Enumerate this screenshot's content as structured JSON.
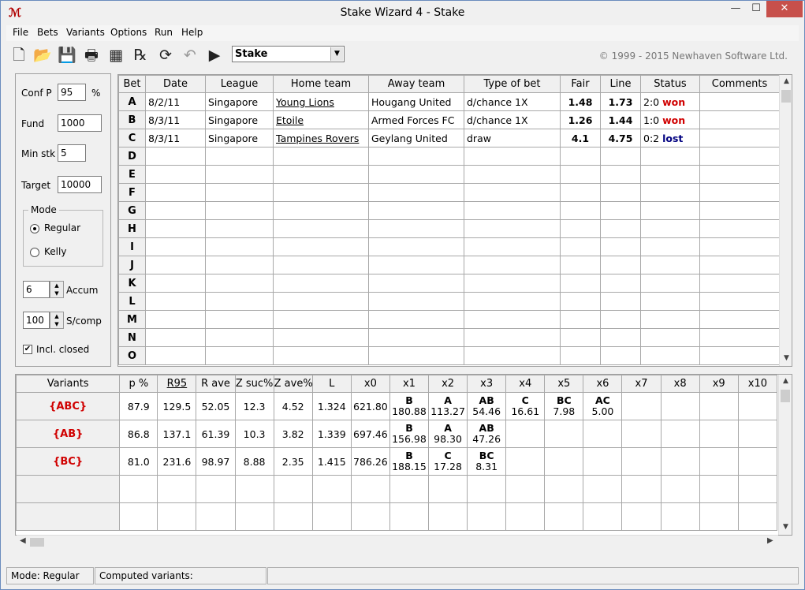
{
  "window": {
    "title": "Stake Wizard 4 - Stake",
    "icon_text": "SW",
    "min": "—",
    "max": "☐",
    "close": "✕"
  },
  "menu": [
    "File",
    "Bets",
    "Variants",
    "Options",
    "Run",
    "Help"
  ],
  "toolbar": {
    "icons": [
      "new-file-icon",
      "open-folder-icon",
      "save-icon",
      "print-icon",
      "calculator-icon",
      "results-icon",
      "refresh-icon",
      "undo-icon",
      "run-icon"
    ],
    "stake_selection": "Stake",
    "copyright": "© 1999 - 2015 Newhaven Software Ltd."
  },
  "params": {
    "conf_p_label": "Conf P",
    "conf_p": "95",
    "conf_p_unit": "%",
    "fund_label": "Fund",
    "fund": "1000",
    "min_stk_label": "Min stk",
    "min_stk": "5",
    "target_label": "Target",
    "target": "10000",
    "mode_label": "Mode",
    "mode_regular": "Regular",
    "mode_kelly": "Kelly",
    "mode_selected": "Regular",
    "accum": "6",
    "accum_label": "Accum",
    "scomp": "100",
    "scomp_label": "S/comp",
    "incl_closed_label": "Incl. closed",
    "incl_closed": true
  },
  "bets": {
    "columns": [
      "Bet",
      "Date",
      "League",
      "Home team",
      "Away team",
      "Type of bet",
      "Fair",
      "Line",
      "Status",
      "Comments"
    ],
    "rows": [
      {
        "id": "A",
        "date": "8/2/11",
        "league": "Singapore",
        "home": "Young Lions",
        "away": "Hougang United",
        "type": "d/chance 1X",
        "fair": "1.48",
        "line": "1.73",
        "score": "2:0",
        "result": "won",
        "comments": ""
      },
      {
        "id": "B",
        "date": "8/3/11",
        "league": "Singapore",
        "home": "Etoile",
        "away": "Armed Forces FC",
        "type": "d/chance 1X",
        "fair": "1.26",
        "line": "1.44",
        "score": "1:0",
        "result": "won",
        "comments": ""
      },
      {
        "id": "C",
        "date": "8/3/11",
        "league": "Singapore",
        "home": "Tampines Rovers",
        "away": "Geylang United",
        "type": "draw",
        "fair": "4.1",
        "line": "4.75",
        "score": "0:2",
        "result": "lost",
        "comments": ""
      }
    ],
    "empty_rows": [
      "D",
      "E",
      "F",
      "G",
      "H",
      "I",
      "J",
      "K",
      "L",
      "M",
      "N",
      "O"
    ]
  },
  "variants": {
    "columns": [
      "Variants",
      "p %",
      "R95",
      "R ave",
      "Z suc%",
      "Z ave%",
      "L",
      "x0",
      "x1",
      "x2",
      "x3",
      "x4",
      "x5",
      "x6",
      "x7",
      "x8",
      "x9",
      "x10"
    ],
    "rows": [
      {
        "name": "{ABC}",
        "p": "87.9",
        "r95": "129.5",
        "rave": "52.05",
        "zsuc": "12.3",
        "zave": "4.52",
        "l": "1.324",
        "x0": "621.80",
        "x": [
          {
            "k": "B",
            "v": "180.88"
          },
          {
            "k": "A",
            "v": "113.27"
          },
          {
            "k": "AB",
            "v": "54.46"
          },
          {
            "k": "C",
            "v": "16.61"
          },
          {
            "k": "BC",
            "v": "7.98"
          },
          {
            "k": "AC",
            "v": "5.00"
          },
          null,
          null,
          null,
          null
        ]
      },
      {
        "name": "{AB}",
        "p": "86.8",
        "r95": "137.1",
        "rave": "61.39",
        "zsuc": "10.3",
        "zave": "3.82",
        "l": "1.339",
        "x0": "697.46",
        "x": [
          {
            "k": "B",
            "v": "156.98"
          },
          {
            "k": "A",
            "v": "98.30"
          },
          {
            "k": "AB",
            "v": "47.26"
          },
          null,
          null,
          null,
          null,
          null,
          null,
          null
        ]
      },
      {
        "name": "{BC}",
        "p": "81.0",
        "r95": "231.6",
        "rave": "98.97",
        "zsuc": "8.88",
        "zave": "2.35",
        "l": "1.415",
        "x0": "786.26",
        "x": [
          {
            "k": "B",
            "v": "188.15"
          },
          {
            "k": "C",
            "v": "17.28"
          },
          {
            "k": "BC",
            "v": "8.31"
          },
          null,
          null,
          null,
          null,
          null,
          null,
          null
        ]
      }
    ],
    "empty_rows": 2
  },
  "status": {
    "mode": "Mode: Regular",
    "computed": "Computed variants:",
    "extra": ""
  }
}
